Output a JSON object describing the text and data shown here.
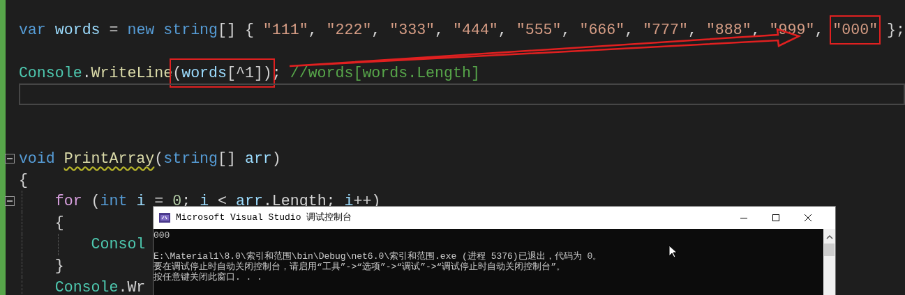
{
  "editor": {
    "lines": [
      {
        "segments": [
          {
            "tokens": [
              {
                "text": "var ",
                "kind": "keyword"
              },
              {
                "text": "words",
                "kind": "ident"
              },
              {
                "text": " = ",
                "kind": "plain"
              },
              {
                "text": "new ",
                "kind": "keyword"
              },
              {
                "text": "string",
                "kind": "keyword"
              },
              {
                "text": "[] { ",
                "kind": "plain"
              },
              {
                "text": "\"111\"",
                "kind": "string"
              },
              {
                "text": ", ",
                "kind": "plain"
              },
              {
                "text": "\"222\"",
                "kind": "string"
              },
              {
                "text": ", ",
                "kind": "plain"
              },
              {
                "text": "\"333\"",
                "kind": "string"
              },
              {
                "text": ", ",
                "kind": "plain"
              },
              {
                "text": "\"444\"",
                "kind": "string"
              },
              {
                "text": ", ",
                "kind": "plain"
              },
              {
                "text": "\"555\"",
                "kind": "string"
              },
              {
                "text": ", ",
                "kind": "plain"
              },
              {
                "text": "\"666\"",
                "kind": "string"
              },
              {
                "text": ", ",
                "kind": "plain"
              },
              {
                "text": "\"777\"",
                "kind": "string"
              },
              {
                "text": ", ",
                "kind": "plain"
              },
              {
                "text": "\"888\"",
                "kind": "string"
              },
              {
                "text": ", ",
                "kind": "plain"
              },
              {
                "text": "\"999\"",
                "kind": "string"
              },
              {
                "text": ", ",
                "kind": "plain"
              }
            ]
          },
          {
            "highlighted": true,
            "tokens": [
              {
                "text": "\"000\"",
                "kind": "string"
              }
            ]
          },
          {
            "tokens": [
              {
                "text": " };",
                "kind": "plain"
              }
            ]
          }
        ]
      },
      {
        "kind": "blank"
      },
      {
        "segments": [
          {
            "tokens": [
              {
                "text": "Console",
                "kind": "type"
              },
              {
                "text": ".",
                "kind": "plain"
              },
              {
                "text": "WriteLine",
                "kind": "method"
              }
            ]
          },
          {
            "highlighted": true,
            "tokens": [
              {
                "text": "(",
                "kind": "plain"
              },
              {
                "text": "words",
                "kind": "ident"
              },
              {
                "text": "[^1])",
                "kind": "plain"
              }
            ]
          },
          {
            "tokens": [
              {
                "text": "; ",
                "kind": "plain"
              },
              {
                "text": "//words[words.Length]",
                "kind": "comment"
              }
            ]
          }
        ]
      },
      {
        "kind": "blank",
        "current": true
      },
      {
        "kind": "blank"
      },
      {
        "kind": "blank"
      },
      {
        "fold": true,
        "segments": [
          {
            "tokens": [
              {
                "text": "void ",
                "kind": "keyword"
              }
            ]
          },
          {
            "squiggle": true,
            "tokens": [
              {
                "text": "PrintArray",
                "kind": "method"
              }
            ]
          },
          {
            "tokens": [
              {
                "text": "(",
                "kind": "plain"
              },
              {
                "text": "string",
                "kind": "keyword"
              },
              {
                "text": "[] ",
                "kind": "plain"
              },
              {
                "text": "arr",
                "kind": "ident"
              },
              {
                "text": ")",
                "kind": "plain"
              }
            ]
          }
        ]
      },
      {
        "segments": [
          {
            "tokens": [
              {
                "text": "{",
                "kind": "plain"
              }
            ]
          }
        ],
        "children": [
          {
            "fold": true,
            "segments": [
              {
                "tokens": [
                  {
                    "text": "for",
                    "kind": "control"
                  },
                  {
                    "text": " (",
                    "kind": "plain"
                  },
                  {
                    "text": "int ",
                    "kind": "keyword"
                  },
                  {
                    "text": "i",
                    "kind": "ident"
                  },
                  {
                    "text": " = ",
                    "kind": "plain"
                  },
                  {
                    "text": "0",
                    "kind": "number"
                  },
                  {
                    "text": "; ",
                    "kind": "plain"
                  },
                  {
                    "text": "i",
                    "kind": "ident"
                  },
                  {
                    "text": " < ",
                    "kind": "plain"
                  },
                  {
                    "text": "arr",
                    "kind": "ident"
                  },
                  {
                    "text": ".Length; ",
                    "kind": "plain"
                  },
                  {
                    "text": "i",
                    "kind": "ident"
                  },
                  {
                    "text": "++)",
                    "kind": "plain"
                  }
                ]
              }
            ]
          },
          {
            "segments": [
              {
                "tokens": [
                  {
                    "text": "{",
                    "kind": "plain"
                  }
                ]
              }
            ],
            "children": [
              {
                "segments": [
                  {
                    "tokens": [
                      {
                        "text": "Consol",
                        "kind": "type"
                      }
                    ]
                  }
                ]
              }
            ]
          },
          {
            "segments": [
              {
                "tokens": [
                  {
                    "text": "}",
                    "kind": "plain"
                  }
                ]
              }
            ]
          },
          {
            "segments": [
              {
                "tokens": [
                  {
                    "text": "Console",
                    "kind": "type"
                  },
                  {
                    "text": ".Wr",
                    "kind": "plain"
                  }
                ]
              }
            ]
          }
        ]
      }
    ]
  },
  "console": {
    "title": "Microsoft Visual Studio 调试控制台",
    "lines": [
      {
        "text": "000"
      },
      {
        "kind": "blank"
      },
      {
        "text": "E:\\Material1\\8.0\\索引和范围\\bin\\Debug\\net6.0\\索引和范围.exe (进程 5376)已退出，代码为 0。"
      },
      {
        "text": "要在调试停止时自动关闭控制台，请启用“工具”->“选项”->“调试”->“调试停止时自动关闭控制台”。"
      },
      {
        "text": "按任意键关闭此窗口. . ."
      }
    ]
  }
}
